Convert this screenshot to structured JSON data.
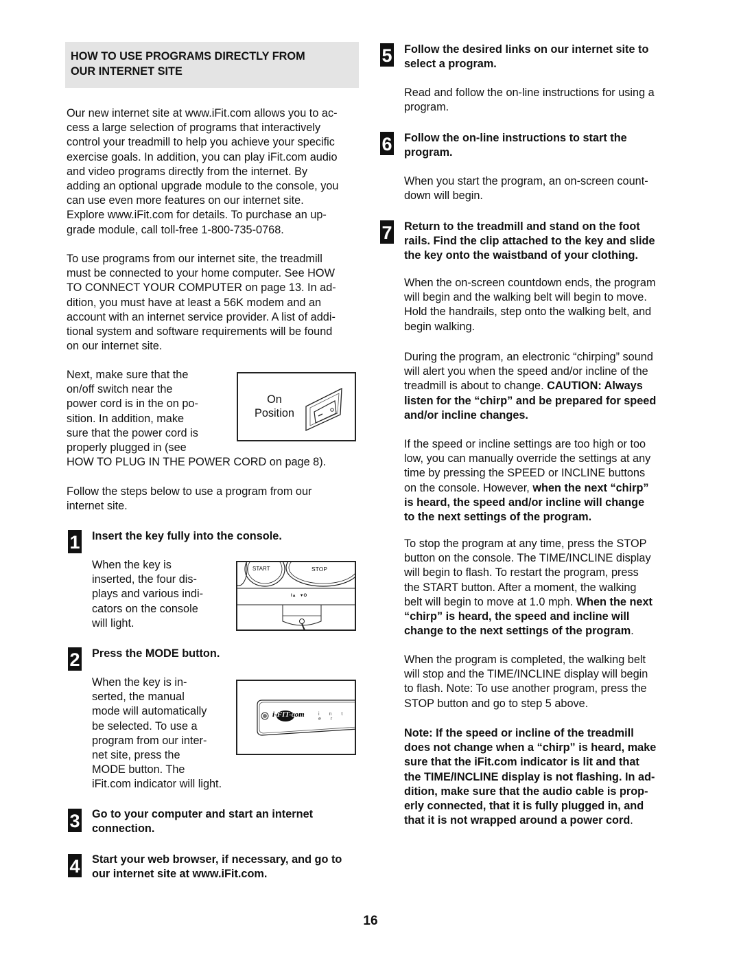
{
  "left": {
    "section_heading": [
      "HOW TO USE PROGRAMS DIRECTLY FROM",
      "OUR INTERNET SITE"
    ],
    "intro_lines": [
      "Our new internet site at www.iFit.com allows you to ac-",
      "cess a large selection of programs that interactively",
      "control your treadmill to help you achieve your specific",
      "exercise goals. In addition, you can play iFit.com audio",
      "and video programs directly from the internet. By",
      "adding an optional upgrade module to the console, you",
      "can use even more features on our internet site.",
      "Explore www.iFit.com for details. To purchase an up-",
      "grade module, call toll-free 1-800-735-0768."
    ],
    "requirements_lines": [
      "To use programs from our internet site, the treadmill",
      "must be connected to your home computer. See HOW",
      "TO CONNECT YOUR COMPUTER on page 13. In ad-",
      "dition, you must have at least a 56K modem and an",
      "account with an internet service provider. A list of addi-",
      "tional system and software requirements will be found",
      "on our internet site."
    ],
    "switch_lines": [
      "Next, make sure that the",
      "on/off switch near the",
      "power cord is in the on po-",
      "sition. In addition, make",
      "sure that the power cord is",
      "properly plugged in (see",
      "HOW TO PLUG IN THE POWER CORD on page 8)."
    ],
    "switch_figure": {
      "label_line1": "On",
      "label_line2": "Position"
    },
    "follow_lines": [
      "Follow the steps below to use a program from our",
      "internet site."
    ]
  },
  "steps": [
    {
      "number": "1",
      "title": [
        "Insert the key fully into the console."
      ],
      "body": [
        "When the key is",
        "inserted, the four dis-",
        "plays and various indi-",
        "cators on the console",
        "will light."
      ],
      "figure": {
        "start_label": "START",
        "stop_label": "STOP",
        "indicator_label": "I▲   ▼O"
      }
    },
    {
      "number": "2",
      "title": [
        "Press the MODE button."
      ],
      "body": [
        "When the key is in-",
        "serted, the manual",
        "mode will automatically",
        "be selected. To use a",
        "program from our inter-",
        "net site, press the",
        "MODE button. The",
        "iFit.com indicator will light."
      ],
      "figure": {
        "logo_text": "i-FIT-com",
        "trailing_text": "i n t e r"
      }
    },
    {
      "number": "3",
      "title": [
        "Go to your computer and start an internet",
        "connection."
      ]
    },
    {
      "number": "4",
      "title": [
        "Start your web browser, if necessary, and go to",
        "our internet site at www.iFit.com."
      ]
    },
    {
      "number": "5",
      "title": [
        "Follow the desired links on our internet site to",
        "select a program."
      ],
      "body": [
        "Read and follow the on-line instructions for using a",
        "program."
      ]
    },
    {
      "number": "6",
      "title": [
        "Follow the on-line instructions to start the",
        "program."
      ],
      "body": [
        "When you start the program, an on-screen count-",
        "down will begin."
      ]
    },
    {
      "number": "7",
      "title": [
        "Return to the treadmill and stand on the foot",
        "rails. Find the clip attached to the key and slide",
        "the key onto the waistband of your clothing."
      ],
      "body": [
        "When the on-screen countdown ends, the program",
        "will begin and the walking belt will begin to move.",
        "Hold the handrails, step onto the walking belt, and",
        "begin walking."
      ]
    }
  ],
  "right": {
    "chirp": {
      "l1": "During the program, an electronic “chirping” sound",
      "l2": "will alert you when the speed and/or incline of the",
      "l3_normal": "treadmill is about to change. ",
      "l3_bold": "CAUTION: Always",
      "l4": "listen for the “chirp” and be prepared for speed",
      "l5": "and/or incline changes."
    },
    "override": {
      "l1": "If the speed or incline settings are too high or too",
      "l2": "low, you can manually override the settings at any",
      "l3": "time by pressing the SPEED or INCLINE buttons",
      "l4_normal": "on the console. However, ",
      "l4_bold": "when the next “chirp”",
      "l5": "is heard, the speed and/or incline will change",
      "l6": "to the next settings of the program."
    },
    "stop": {
      "l1": "To stop the program at any time, press the STOP",
      "l2": "button on the console. The TIME/INCLINE display",
      "l3": "will begin to flash. To restart the program, press",
      "l4": "the START button. After a moment, the walking",
      "l5_normal": "belt will begin to move at 1.0 mph. ",
      "l5_bold": "When the next",
      "l6": "“chirp” is heard, the speed and incline will",
      "l7_bold": "change to the next settings of the program",
      "l7_normal": "."
    },
    "completed_lines": [
      "When the program is completed, the walking belt",
      "will stop and the TIME/INCLINE display will begin",
      "to flash. Note: To use another program, press the",
      "STOP button and go to step 5 above."
    ],
    "note_lines": [
      "Note: If the speed or incline of the treadmill",
      "does not change when a “chirp” is heard, make",
      "sure that the iFit.com indicator is lit and that",
      "the TIME/INCLINE display is not flashing. In ad-",
      "dition, make sure that the audio cable is prop-",
      "erly connected, that it is fully plugged in, and"
    ],
    "note_last_bold": "that it is not wrapped around a power cord",
    "note_last_normal": "."
  },
  "page_number": "16"
}
